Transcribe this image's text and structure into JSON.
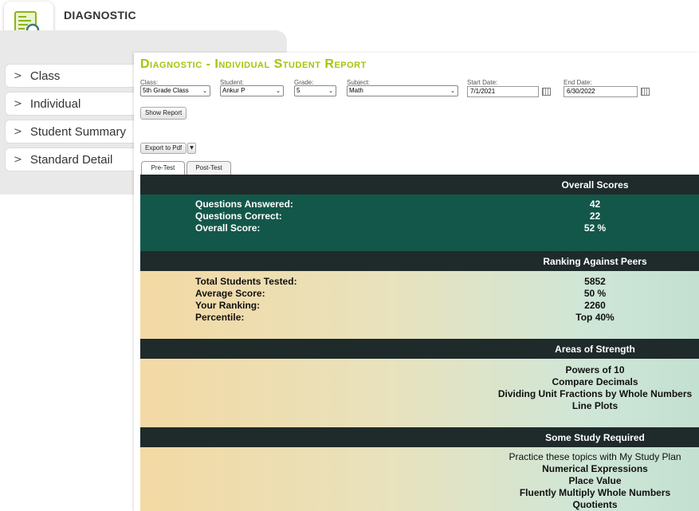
{
  "app": {
    "brand": "DIAGNOSTIC"
  },
  "sidebar": {
    "items": [
      {
        "label": "Class"
      },
      {
        "label": "Individual"
      },
      {
        "label": "Student Summary"
      },
      {
        "label": "Standard Detail"
      }
    ]
  },
  "report": {
    "title": "Diagnostic - Individual Student Report",
    "filters": {
      "class": {
        "label": "Class:",
        "value": "5th Grade Class"
      },
      "student": {
        "label": "Student:",
        "value": "Ankur P"
      },
      "grade": {
        "label": "Grade:",
        "value": "5"
      },
      "subject": {
        "label": "Subject:",
        "value": "Math"
      },
      "start_date": {
        "label": "Start Date:",
        "value": "7/1/2021"
      },
      "end_date": {
        "label": "End Date:",
        "value": "6/30/2022"
      }
    },
    "show_report_label": "Show Report",
    "export_label": "Export to Pdf",
    "tabs": [
      {
        "label": "Pre-Test"
      },
      {
        "label": "Post-Test"
      }
    ],
    "overall": {
      "header": "Overall Scores",
      "rows": [
        {
          "label": "Questions Answered:",
          "value": "42"
        },
        {
          "label": "Questions Correct:",
          "value": "22"
        },
        {
          "label": "Overall Score:",
          "value": "52 %"
        }
      ]
    },
    "ranking": {
      "header": "Ranking Against Peers",
      "rows": [
        {
          "label": "Total Students Tested:",
          "value": "5852"
        },
        {
          "label": "Average Score:",
          "value": "50 %"
        },
        {
          "label": "Your Ranking:",
          "value": "2260"
        },
        {
          "label": "Percentile:",
          "value": "Top 40%"
        }
      ]
    },
    "strength": {
      "header": "Areas of Strength",
      "items": [
        "Powers of 10",
        "Compare Decimals",
        "Dividing Unit Fractions by Whole Numbers",
        "Line Plots"
      ]
    },
    "study": {
      "header": "Some Study Required",
      "intro": "Practice these topics with My Study Plan",
      "items": [
        "Numerical Expressions",
        "Place Value",
        "Fluently Multiply Whole Numbers",
        "Quotients"
      ]
    }
  },
  "colors": {
    "accent": "#a6c40a",
    "header_bg": "#1f2a2a",
    "overall_bg": "#13574a"
  }
}
